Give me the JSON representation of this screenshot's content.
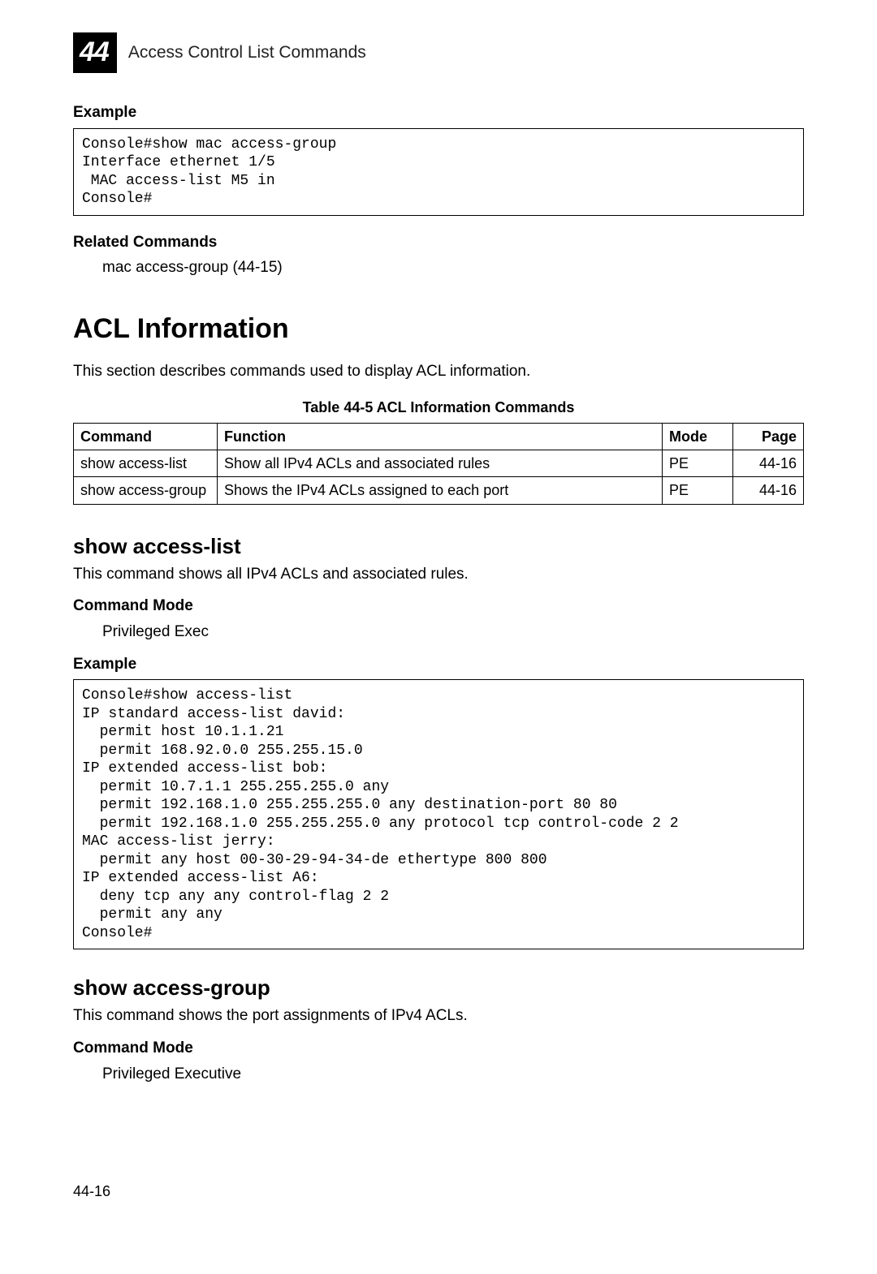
{
  "header": {
    "chapter_number": "44",
    "chapter_title": "Access Control List Commands"
  },
  "example1_label": "Example",
  "example1_code": "Console#show mac access-group\nInterface ethernet 1/5\n MAC access-list M5 in\nConsole#",
  "related_label": "Related Commands",
  "related_text": "mac access-group (44-15)",
  "section_title": "ACL Information",
  "section_intro": "This section describes commands used to display ACL information.",
  "table_caption": "Table 44-5   ACL Information Commands",
  "table": {
    "headers": {
      "command": "Command",
      "function": "Function",
      "mode": "Mode",
      "page": "Page"
    },
    "rows": [
      {
        "command": "show access-list",
        "function": "Show all IPv4 ACLs and associated rules",
        "mode": "PE",
        "page": "44-16"
      },
      {
        "command": "show access-group",
        "function": "Shows the IPv4 ACLs assigned to each port",
        "mode": "PE",
        "page": "44-16"
      }
    ]
  },
  "show_access_list": {
    "title": "show access-list",
    "desc": "This command shows all IPv4 ACLs and associated rules.",
    "mode_label": "Command Mode",
    "mode_value": "Privileged Exec",
    "example_label": "Example",
    "example_code": "Console#show access-list\nIP standard access-list david:\n  permit host 10.1.1.21\n  permit 168.92.0.0 255.255.15.0\nIP extended access-list bob:\n  permit 10.7.1.1 255.255.255.0 any\n  permit 192.168.1.0 255.255.255.0 any destination-port 80 80\n  permit 192.168.1.0 255.255.255.0 any protocol tcp control-code 2 2\nMAC access-list jerry:\n  permit any host 00-30-29-94-34-de ethertype 800 800\nIP extended access-list A6:\n  deny tcp any any control-flag 2 2\n  permit any any\nConsole#"
  },
  "show_access_group": {
    "title": "show access-group",
    "desc": "This command shows the port assignments of IPv4 ACLs.",
    "mode_label": "Command Mode",
    "mode_value": "Privileged Executive"
  },
  "page_number": "44-16"
}
